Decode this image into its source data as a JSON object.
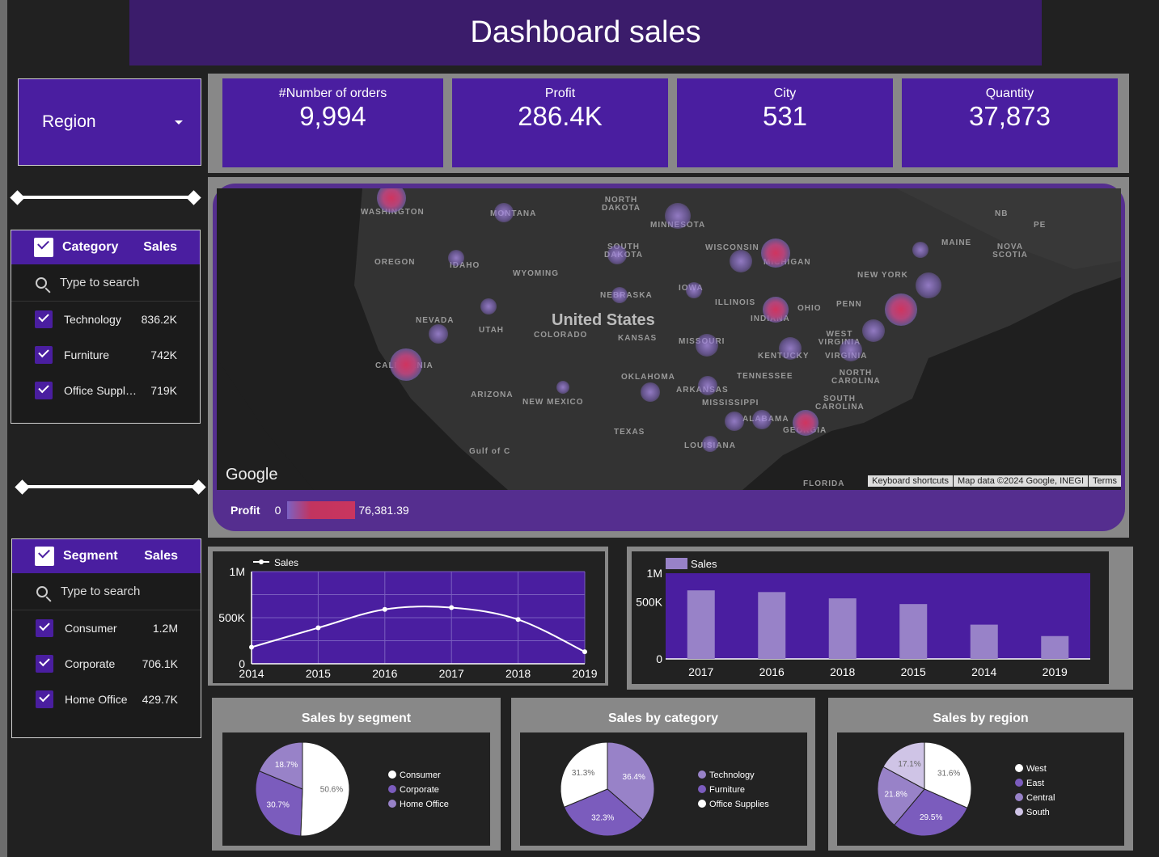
{
  "title": "Dashboard sales",
  "region_control": {
    "label": "Region"
  },
  "kpis": [
    {
      "label": "#Number of orders",
      "value": "9,994"
    },
    {
      "label": "Profit",
      "value": "286.4K"
    },
    {
      "label": "City",
      "value": "531"
    },
    {
      "label": "Quantity",
      "value": "37,873"
    }
  ],
  "category_filter": {
    "header": "Category",
    "sales_header": "Sales",
    "search_placeholder": "Type to search",
    "items": [
      {
        "name": "Technology",
        "value": "836.2K"
      },
      {
        "name": "Furniture",
        "value": "742K"
      },
      {
        "name": "Office Suppl…",
        "value": "719K"
      }
    ]
  },
  "segment_filter": {
    "header": "Segment",
    "sales_header": "Sales",
    "search_placeholder": "Type to search",
    "items": [
      {
        "name": "Consumer",
        "value": "1.2M"
      },
      {
        "name": "Corporate",
        "value": "706.1K"
      },
      {
        "name": "Home Office",
        "value": "429.7K"
      }
    ]
  },
  "map": {
    "country_label": "United States",
    "state_labels": [
      "WASHINGTON",
      "MONTANA",
      "NORTH DAKOTA",
      "MINNESOTA",
      "OREGON",
      "IDAHO",
      "SOUTH DAKOTA",
      "WYOMING",
      "WISCONSIN",
      "MICHIGAN",
      "NEW YORK",
      "NEBRASKA",
      "IOWA",
      "NEVADA",
      "UTAH",
      "COLORADO",
      "KANSAS",
      "ILLINOIS",
      "INDIANA",
      "OHIO",
      "PENN",
      "CALIFORNIA",
      "MISSOURI",
      "WEST VIRGINIA",
      "KENTUCKY",
      "VIRGINIA",
      "ARIZONA",
      "NEW MEXICO",
      "OKLAHOMA",
      "ARKANSAS",
      "TENNESSEE",
      "NORTH CAROLINA",
      "MISSISSIPPI",
      "SOUTH CAROLINA",
      "ALABAMA",
      "GEORGIA",
      "TEXAS",
      "LOUISIANA",
      "FLORIDA",
      "MAINE",
      "NB",
      "PE",
      "NOVA SCOTIA",
      "Gulf of C"
    ],
    "google_logo": "Google",
    "attribution": [
      "Keyboard shortcuts",
      "Map data ©2024 Google, INEGI",
      "Terms"
    ],
    "legend": {
      "label": "Profit",
      "min": "0",
      "max": "76,381.39"
    }
  },
  "chart_data": [
    {
      "type": "line",
      "legend": [
        "Sales"
      ],
      "x": [
        "2014",
        "2015",
        "2016",
        "2017",
        "2018",
        "2019"
      ],
      "series": [
        {
          "name": "Sales",
          "values": [
            180000,
            390000,
            590000,
            610000,
            480000,
            130000
          ]
        }
      ],
      "yticks": [
        "0",
        "500K",
        "1M"
      ],
      "ylim": [
        0,
        1000000
      ],
      "grid": true
    },
    {
      "type": "bar",
      "legend": [
        "Sales"
      ],
      "categories": [
        "2017",
        "2016",
        "2018",
        "2015",
        "2014",
        "2019"
      ],
      "series": [
        {
          "name": "Sales",
          "values": [
            600000,
            585000,
            530000,
            480000,
            300000,
            200000
          ]
        }
      ],
      "yticks": [
        "0",
        "500K",
        "1M"
      ],
      "ylim": [
        0,
        750000
      ]
    },
    {
      "type": "pie",
      "title": "Sales by segment",
      "labels": [
        "Consumer",
        "Corporate",
        "Home Office"
      ],
      "values": [
        50.6,
        30.7,
        18.7
      ],
      "value_labels": [
        "50.6%",
        "30.7%",
        "18.7%"
      ],
      "colors": [
        "#ffffff",
        "#7b5cbd",
        "#9882c8"
      ]
    },
    {
      "type": "pie",
      "title": "Sales by category",
      "labels": [
        "Technology",
        "Furniture",
        "Office Supplies"
      ],
      "values": [
        36.4,
        32.3,
        31.3
      ],
      "value_labels": [
        "36.4%",
        "32.3%",
        "31.3%"
      ],
      "colors": [
        "#9882c8",
        "#7b5cbd",
        "#ffffff"
      ]
    },
    {
      "type": "pie",
      "title": "Sales by region",
      "labels": [
        "West",
        "East",
        "Central",
        "South"
      ],
      "values": [
        31.6,
        29.5,
        21.8,
        17.1
      ],
      "value_labels": [
        "31.6%",
        "29.5%",
        "21.8%",
        "17.1%"
      ],
      "colors": [
        "#ffffff",
        "#7b5cbd",
        "#9882c8",
        "#cfc4e6"
      ]
    }
  ]
}
